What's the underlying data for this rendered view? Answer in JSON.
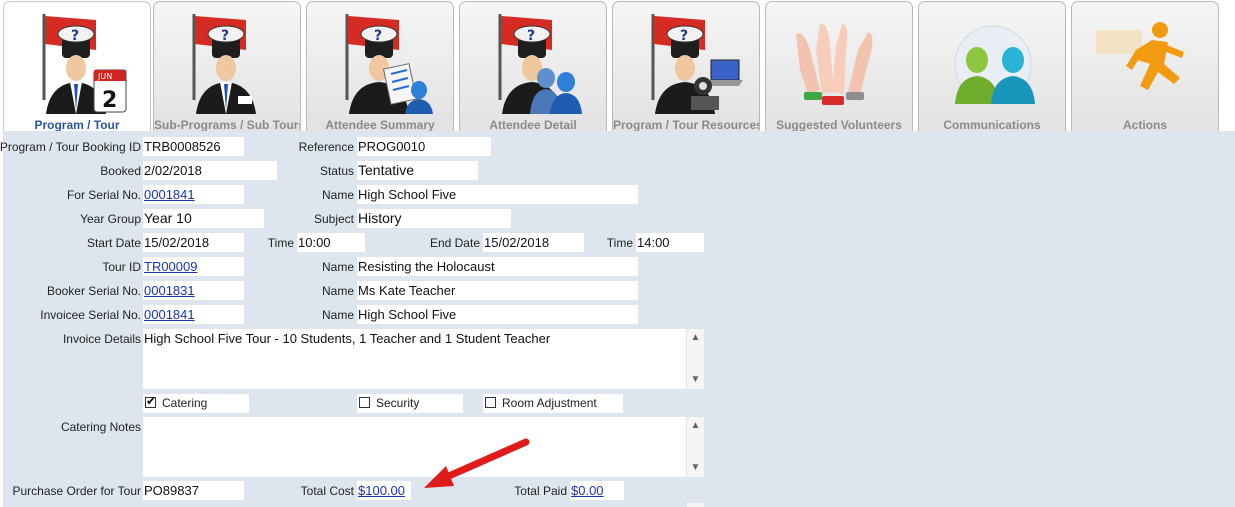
{
  "tabs": [
    {
      "label": "Program / Tour",
      "icon": "manager-calendar-icon"
    },
    {
      "label": "Sub-Programs / Sub Tours",
      "icon": "manager-badge-icon"
    },
    {
      "label": "Attendee Summary",
      "icon": "manager-attendee-list-icon"
    },
    {
      "label": "Attendee Detail",
      "icon": "manager-attendees-icon"
    },
    {
      "label": "Program / Tour Resources",
      "icon": "manager-resources-icon"
    },
    {
      "label": "Suggested Volunteers",
      "icon": "raised-hands-icon"
    },
    {
      "label": "Communications",
      "icon": "people-communication-icon"
    },
    {
      "label": "Actions",
      "icon": "running-man-icon"
    }
  ],
  "form": {
    "booking_id_label": "Program / Tour Booking ID",
    "booking_id": "TRB0008526",
    "reference_label": "Reference",
    "reference": "PROG0010",
    "booked_label": "Booked",
    "booked": "2/02/2018",
    "status_label": "Status",
    "status": "Tentative",
    "serial_label": "For Serial No.",
    "serial": "0001841",
    "name1_label": "Name",
    "name1": "High School Five",
    "year_label": "Year Group",
    "year": "Year 10",
    "subject_label": "Subject",
    "subject": "History",
    "start_label": "Start Date",
    "start": "15/02/2018",
    "time1_label": "Time",
    "time1": "10:00",
    "end_label": "End Date",
    "end": "15/02/2018",
    "time2_label": "Time",
    "time2": "14:00",
    "tour_label": "Tour ID",
    "tour": "TR00009",
    "name2_label": "Name",
    "name2": "Resisting the Holocaust",
    "booker_label": "Booker Serial No.",
    "booker": "0001831",
    "name3_label": "Name",
    "name3": "Ms Kate Teacher",
    "invoicee_label": "Invoicee Serial No.",
    "invoicee": "0001841",
    "name4_label": "Name",
    "name4": "High School Five",
    "invoice_details_label": "Invoice Details",
    "invoice_details": "High School Five Tour - 10 Students, 1 Teacher and 1 Student Teacher",
    "catering_label": "Catering",
    "catering_checked": true,
    "security_label": "Security",
    "security_checked": false,
    "room_label": "Room Adjustment",
    "room_checked": false,
    "catering_notes_label": "Catering Notes",
    "catering_notes": "",
    "po_label": "Purchase Order for Tour",
    "po": "PO89837",
    "total_cost_label": "Total Cost",
    "total_cost": "$100.00",
    "total_paid_label": "Total Paid",
    "total_paid": "$0.00"
  },
  "colors": {
    "panel_bg": "#dde6ee",
    "link": "#1a33b5",
    "active_tab_label": "#2d55a0",
    "annotation_arrow": "#e01b1b"
  }
}
